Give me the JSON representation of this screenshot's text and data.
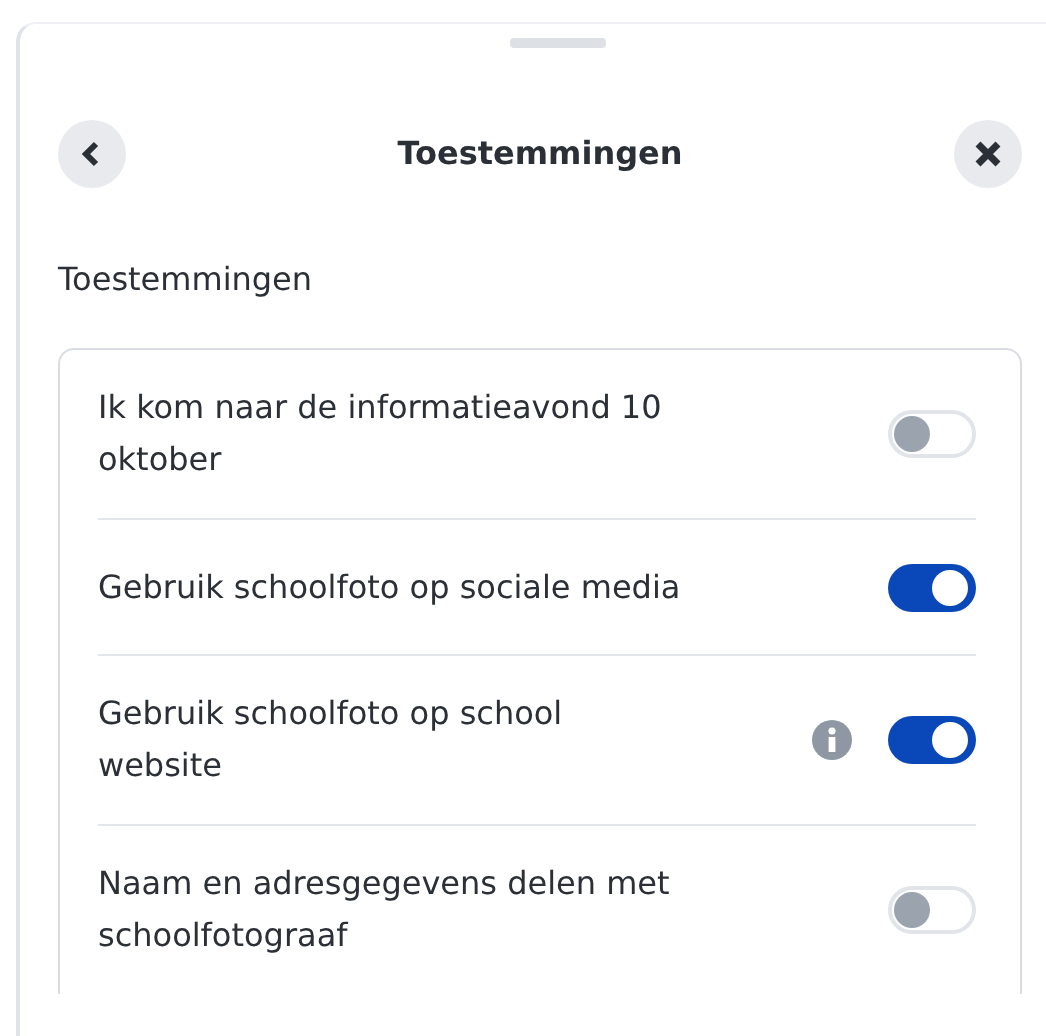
{
  "header": {
    "title": "Toestemmingen"
  },
  "section_title": "Toestemmingen",
  "permissions": [
    {
      "label": "Ik kom naar de informatieavond 10 oktober",
      "on": false,
      "info": false
    },
    {
      "label": "Gebruik schoolfoto op sociale media",
      "on": true,
      "info": false
    },
    {
      "label": "Gebruik schoolfoto op school website",
      "on": true,
      "info": true
    },
    {
      "label": "Naam en adresgegevens delen met schoolfotograaf",
      "on": false,
      "info": false
    }
  ]
}
